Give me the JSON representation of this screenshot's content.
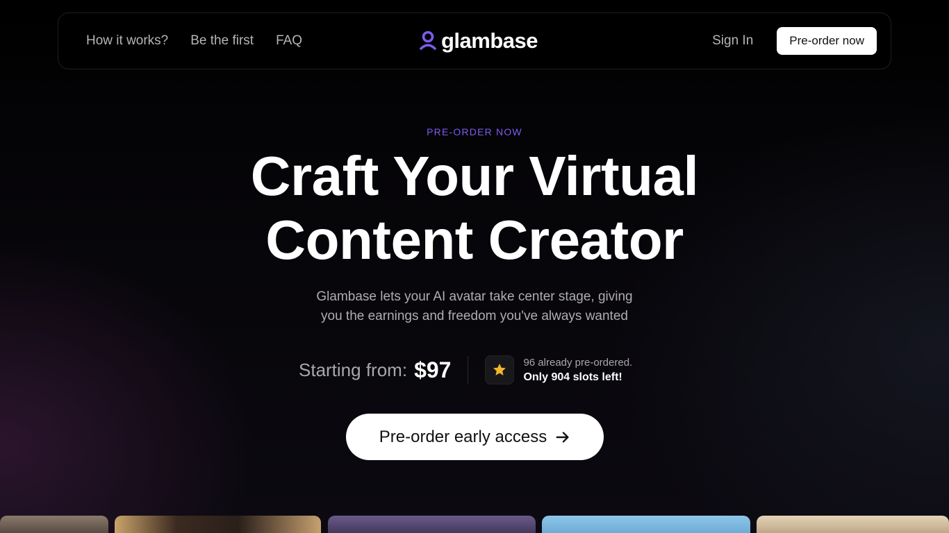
{
  "nav": {
    "links": [
      "How it works?",
      "Be the first",
      "FAQ"
    ],
    "logo_text": "glambase",
    "sign_in": "Sign In",
    "preorder_button": "Pre-order now"
  },
  "hero": {
    "eyebrow": "PRE-ORDER NOW",
    "headline_line1": "Craft Your Virtual",
    "headline_line2": "Content Creator",
    "subtext_line1": "Glambase lets your AI avatar take center stage, giving",
    "subtext_line2": "you the earnings and freedom you've always wanted"
  },
  "pricing": {
    "label": "Starting from:",
    "price": "$97",
    "preordered": "96 already pre-ordered.",
    "slots_left": "Only 904 slots left!"
  },
  "cta": {
    "label": "Pre-order early access"
  },
  "colors": {
    "accent": "#7c5cf0",
    "star": "#f5b72a"
  },
  "icons": {
    "logo": "person-outline-icon",
    "star": "star-icon",
    "cta_arrow": "arrow-right-icon"
  }
}
